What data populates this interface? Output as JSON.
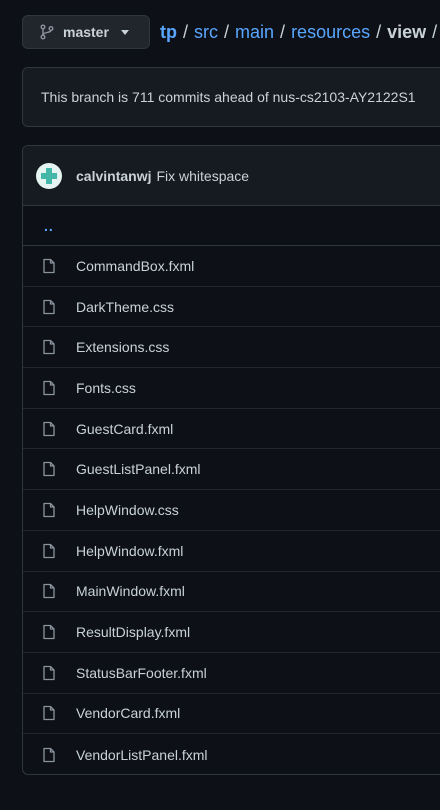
{
  "branch": {
    "name": "master"
  },
  "breadcrumb": {
    "root": "tp",
    "segments": [
      "src",
      "main",
      "resources"
    ],
    "current": "view",
    "separator": "/"
  },
  "ahead_notice": "This branch is 711 commits ahead of nus-cs2103-AY2122S1",
  "commit": {
    "author": "calvintanwj",
    "message": "Fix whitespace"
  },
  "parent_dir": "..",
  "files": [
    "CommandBox.fxml",
    "DarkTheme.css",
    "Extensions.css",
    "Fonts.css",
    "GuestCard.fxml",
    "GuestListPanel.fxml",
    "HelpWindow.css",
    "HelpWindow.fxml",
    "MainWindow.fxml",
    "ResultDisplay.fxml",
    "StatusBarFooter.fxml",
    "VendorCard.fxml",
    "VendorListPanel.fxml"
  ],
  "icons": {
    "branch": "git-branch-icon",
    "caret": "caret-down-icon",
    "file": "file-icon",
    "avatar": "avatar"
  },
  "colors": {
    "background": "#0d1117",
    "link": "#58a6ff",
    "border": "#30363d",
    "text": "#c9d1d9"
  }
}
